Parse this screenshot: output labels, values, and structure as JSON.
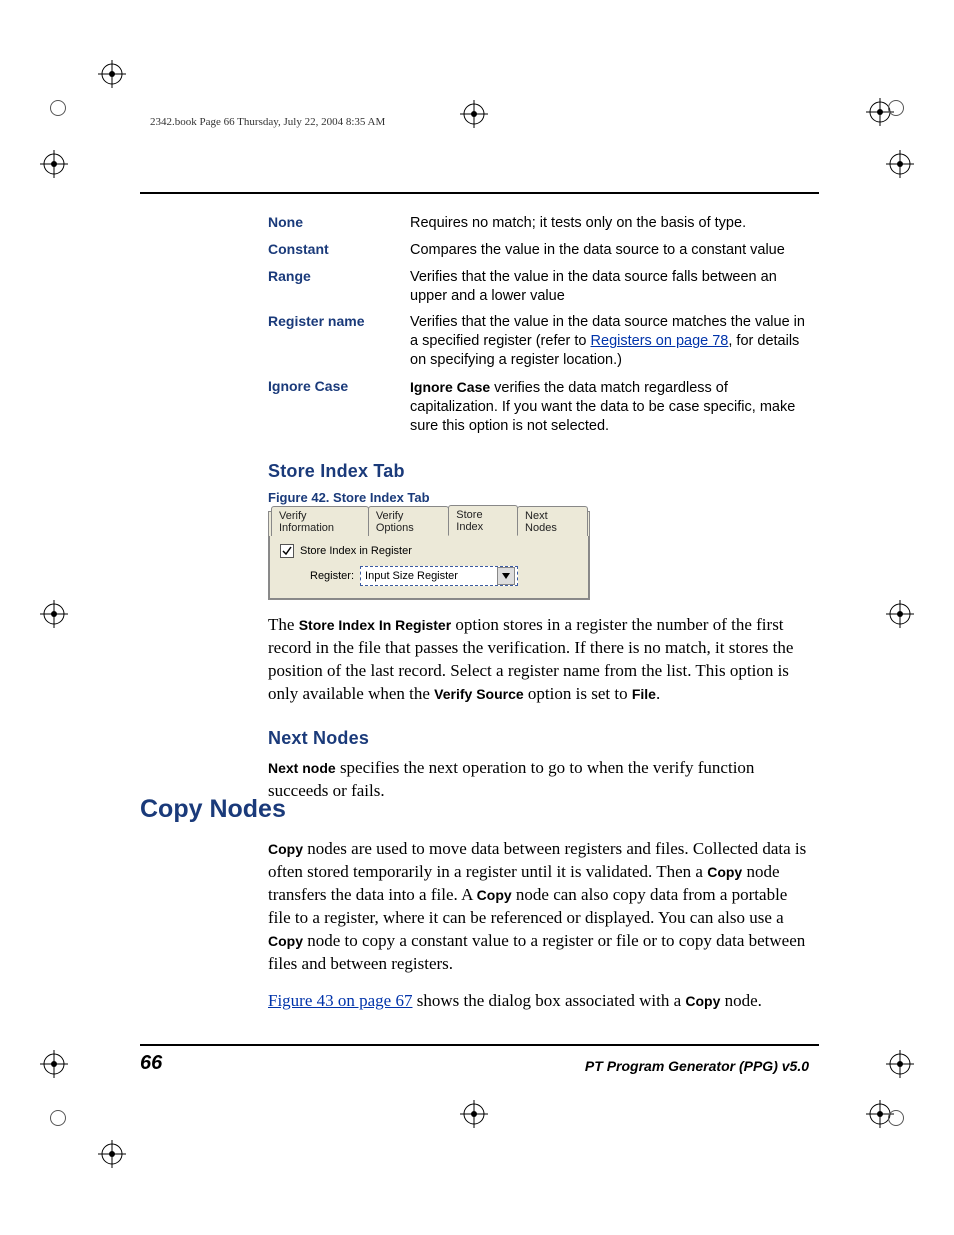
{
  "header_line": "2342.book  Page 66  Thursday, July 22, 2004  8:35 AM",
  "defs": [
    {
      "term": "None",
      "desc": "Requires no match; it tests only on the basis of type."
    },
    {
      "term": "Constant",
      "desc": "Compares the value in the data source to a constant value"
    },
    {
      "term": "Range",
      "desc": "Verifies that the value in the data source falls between an upper and a lower value"
    },
    {
      "term": "Register name",
      "desc_pre": "Verifies that the value in the data source matches the value in a specified register (refer to ",
      "link": "Registers on page 78",
      "desc_post": ", for details on specifying a register location.)"
    },
    {
      "term": "Ignore Case",
      "desc_bold": "Ignore Case",
      "desc_rest": " verifies the data match regardless of capitalization. If you want the data to be case specific, make sure this option is not selected."
    }
  ],
  "sec1_title": "Store Index Tab",
  "fig_caption": "Figure 42. Store Index Tab",
  "shot": {
    "tabs": [
      "Verify Information",
      "Verify Options",
      "Store Index",
      "Next Nodes"
    ],
    "active_tab": 2,
    "checkbox_label": "Store Index in Register",
    "reg_label": "Register:",
    "combo_value": "Input Size Register"
  },
  "para_store": {
    "pre": "The ",
    "b1": "Store Index In Register",
    "mid": " option stores in a register the number of the first record in the file that passes the verification. If there is no match, it stores the position of the last record. Select a register name from the list. This option is only available when the ",
    "b2": "Verify Source",
    "mid2": " option is set to ",
    "b3": "File",
    "end": "."
  },
  "sec2_title": "Next Nodes",
  "para_next": {
    "b1": "Next node",
    "rest": " specifies the next operation to go to when the verify function succeeds or fails."
  },
  "h1": "Copy Nodes",
  "para_copy": {
    "b1": "Copy",
    "t1": " nodes are used to move data between registers and files. Collected data is often stored temporarily in a register until it is validated. Then a ",
    "b2": "Copy",
    "t2": " node transfers the data into a file. A ",
    "b3": "Copy",
    "t3": " node can also copy data from a portable file to a register, where it can be referenced or displayed. You can also use a ",
    "b4": "Copy",
    "t4": " node to copy a constant value to a register or file or to copy data between files and between registers."
  },
  "para_fig": {
    "link": "Figure 43 on page 67",
    "rest": " shows the dialog box associated with a ",
    "b1": "Copy",
    "end": " node."
  },
  "page_num": "66",
  "footer_title": "PT Program Generator (PPG)  v5.0"
}
